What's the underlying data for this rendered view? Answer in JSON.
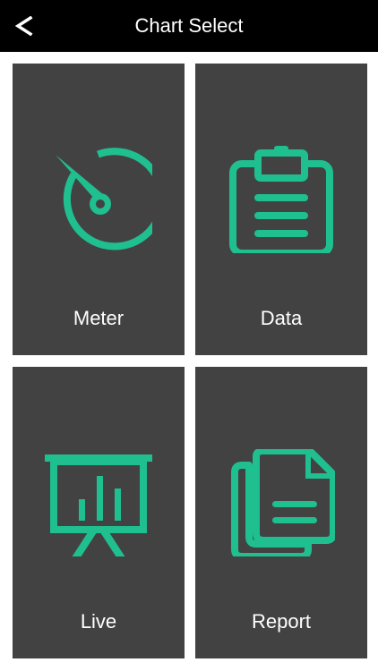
{
  "header": {
    "back_label": "<",
    "title": "Chart Select"
  },
  "tiles": [
    {
      "label": "Meter",
      "icon": "meter-icon"
    },
    {
      "label": "Data",
      "icon": "clipboard-icon"
    },
    {
      "label": "Live",
      "icon": "presentation-chart-icon"
    },
    {
      "label": "Report",
      "icon": "documents-icon"
    }
  ],
  "colors": {
    "accent": "#1fbf8f",
    "tile_bg": "#424242",
    "header_bg": "#000000",
    "text": "#ffffff"
  }
}
